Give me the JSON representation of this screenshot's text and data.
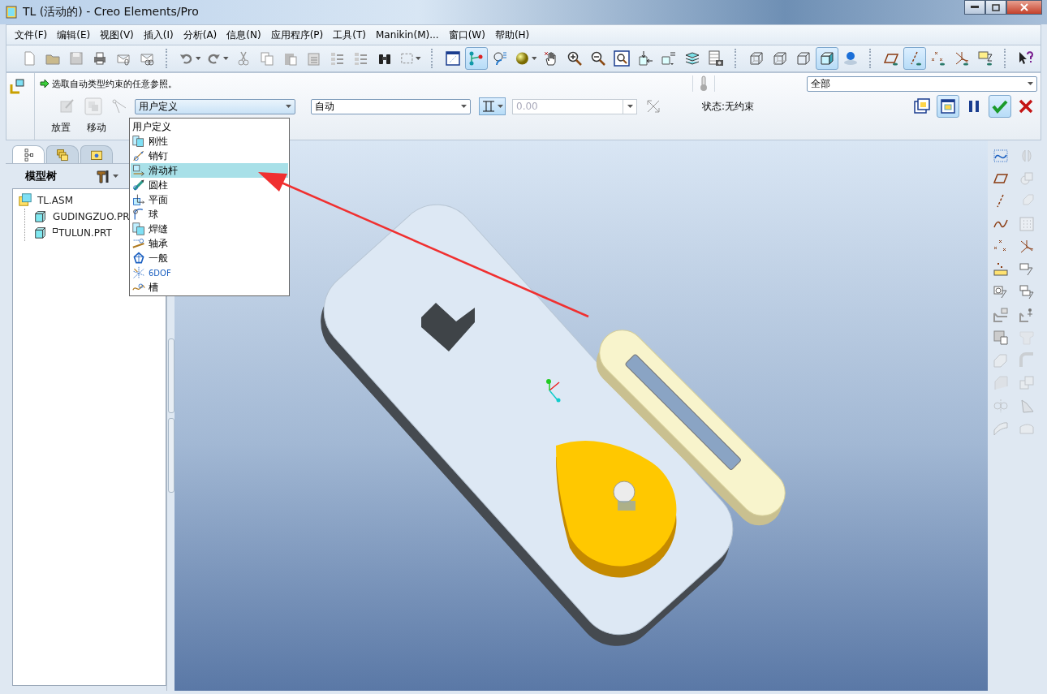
{
  "window": {
    "title": "TL (活动的) - Creo Elements/Pro"
  },
  "menu": [
    "文件(F)",
    "编辑(E)",
    "视图(V)",
    "插入(I)",
    "分析(A)",
    "信息(N)",
    "应用程序(P)",
    "工具(T)",
    "Manikin(M)...",
    "窗口(W)",
    "帮助(H)"
  ],
  "main_toolbar": [
    [
      {
        "kind": "page",
        "pressed": false,
        "dropdown": false
      },
      {
        "kind": "folder",
        "pressed": false,
        "dropdown": false
      },
      {
        "kind": "disk",
        "pressed": false,
        "dropdown": false
      },
      {
        "kind": "printer",
        "pressed": false,
        "dropdown": false
      },
      {
        "kind": "envelope",
        "pressed": false,
        "dropdown": false
      },
      {
        "kind": "envelope-link",
        "pressed": false,
        "dropdown": false
      }
    ],
    [
      {
        "kind": "undo",
        "pressed": false,
        "dropdown": true
      },
      {
        "kind": "redo",
        "pressed": false,
        "dropdown": true
      },
      {
        "kind": "scissors",
        "pressed": false,
        "dropdown": false
      },
      {
        "kind": "copy",
        "pressed": false,
        "dropdown": false
      },
      {
        "kind": "clipboard",
        "pressed": false,
        "dropdown": false
      },
      {
        "kind": "clipboard-list",
        "pressed": false,
        "dropdown": false
      },
      {
        "kind": "list-arrows",
        "pressed": false,
        "dropdown": false
      },
      {
        "kind": "list-arrows",
        "pressed": false,
        "dropdown": false
      },
      {
        "kind": "binoculars",
        "pressed": false,
        "dropdown": false
      },
      {
        "kind": "dashed-box",
        "pressed": false,
        "dropdown": true
      }
    ],
    [
      {
        "kind": "window",
        "pressed": false,
        "dropdown": false
      },
      {
        "kind": "node",
        "pressed": true,
        "dropdown": false
      },
      {
        "kind": "rotate",
        "pressed": false,
        "dropdown": false
      },
      {
        "kind": "sphere",
        "pressed": false,
        "dropdown": true
      },
      {
        "kind": "hand",
        "pressed": false,
        "dropdown": false
      },
      {
        "kind": "zoom-in",
        "pressed": false,
        "dropdown": false
      },
      {
        "kind": "zoom-out",
        "pressed": false,
        "dropdown": false
      },
      {
        "kind": "magnifier-window",
        "pressed": false,
        "dropdown": false
      },
      {
        "kind": "cube-arrow",
        "pressed": false,
        "dropdown": false
      },
      {
        "kind": "cube-label",
        "pressed": false,
        "dropdown": false
      },
      {
        "kind": "layers",
        "pressed": false,
        "dropdown": false
      },
      {
        "kind": "table-camera",
        "pressed": false,
        "dropdown": false
      }
    ],
    [
      {
        "kind": "wireframe-cube",
        "pressed": false,
        "dropdown": false
      },
      {
        "kind": "wireframe-cube",
        "pressed": false,
        "dropdown": false
      },
      {
        "kind": "cube",
        "pressed": false,
        "dropdown": false
      },
      {
        "kind": "shaded-cube",
        "pressed": true,
        "dropdown": false
      },
      {
        "kind": "globe-pin",
        "pressed": false,
        "dropdown": false
      }
    ],
    [
      {
        "kind": "plane",
        "pressed": false,
        "dropdown": false
      },
      {
        "kind": "axis",
        "pressed": true,
        "dropdown": false
      },
      {
        "kind": "points",
        "pressed": false,
        "dropdown": false
      },
      {
        "kind": "csys",
        "pressed": false,
        "dropdown": false
      },
      {
        "kind": "note",
        "pressed": false,
        "dropdown": false
      }
    ],
    [
      {
        "kind": "help",
        "pressed": false,
        "dropdown": false
      }
    ]
  ],
  "dashboard": {
    "prompt": "选取自动类型约束的任意参照。",
    "filter": {
      "value": "全部"
    },
    "constraint_type": {
      "value": "用户定义"
    },
    "constraint": {
      "value": "自动"
    },
    "offset": {
      "placeholder": "0.00",
      "disabled": true
    },
    "status": "状态:无约束",
    "tabs": [
      {
        "label": "放置"
      },
      {
        "label": "移动"
      }
    ],
    "buttons": [
      {
        "kind": "preview-window",
        "pressed": false
      },
      {
        "kind": "preview-window-2",
        "pressed": true
      },
      {
        "kind": "pause",
        "pressed": false
      },
      {
        "kind": "ok",
        "pressed": true
      },
      {
        "kind": "cancel",
        "pressed": false
      }
    ]
  },
  "constraint_type_menu": [
    {
      "label": "用户定义",
      "kind": "plain",
      "selected": false
    },
    {
      "label": "刚性",
      "kind": "rigid",
      "selected": false
    },
    {
      "label": "销钉",
      "kind": "pin",
      "selected": false
    },
    {
      "label": "滑动杆",
      "kind": "slider",
      "selected": true
    },
    {
      "label": "圆柱",
      "kind": "cylinder",
      "selected": false
    },
    {
      "label": "平面",
      "kind": "planar",
      "selected": false
    },
    {
      "label": "球",
      "kind": "ball",
      "selected": false
    },
    {
      "label": "焊缝",
      "kind": "weld",
      "selected": false
    },
    {
      "label": "轴承",
      "kind": "bearing",
      "selected": false
    },
    {
      "label": "一般",
      "kind": "general",
      "selected": false
    },
    {
      "label": "6DOF",
      "kind": "sixdof",
      "selected": false
    },
    {
      "label": "槽",
      "kind": "slot",
      "selected": false
    }
  ],
  "navigator": {
    "tabs": [
      {
        "kind": "tree",
        "selected": true
      },
      {
        "kind": "folders",
        "selected": false
      },
      {
        "kind": "favorites",
        "selected": false
      }
    ],
    "header": "模型树",
    "tree": [
      {
        "label": "TL.ASM",
        "kind": "assembly",
        "children": [
          {
            "label": "GUDINGZUO.PR",
            "kind": "part"
          },
          {
            "label": "TULUN.PRT",
            "kind": "flagged-part"
          }
        ]
      }
    ]
  }
}
